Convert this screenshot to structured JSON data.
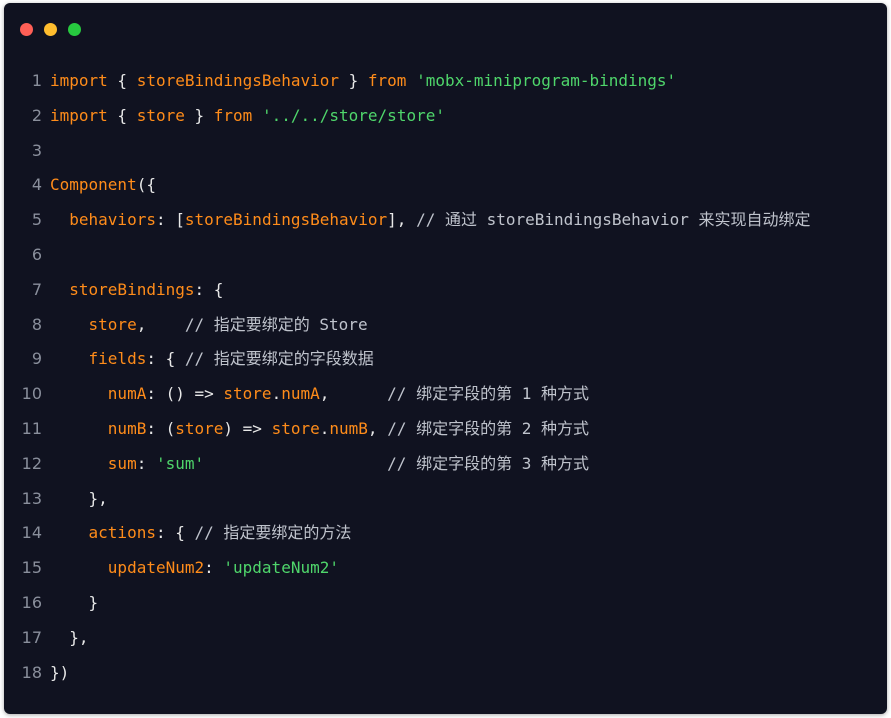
{
  "window": {
    "controls": {
      "close_color": "#ff5f56",
      "minimize_color": "#ffbd2e",
      "maximize_color": "#27c93f"
    }
  },
  "theme": {
    "background": "#101220",
    "keyword": "#ff8c1a",
    "string": "#4fd66b",
    "punctuation": "#e8e8e8",
    "comment": "#bfc3cc",
    "line_number": "#8a8f9c"
  },
  "code": {
    "lines": [
      {
        "num": "1",
        "tokens": [
          [
            "kw",
            "import"
          ],
          [
            "p",
            " { "
          ],
          [
            "id",
            "storeBindingsBehavior"
          ],
          [
            "p",
            " } "
          ],
          [
            "kw",
            "from"
          ],
          [
            "p",
            " "
          ],
          [
            "str",
            "'mobx-miniprogram-bindings'"
          ]
        ]
      },
      {
        "num": "2",
        "tokens": [
          [
            "kw",
            "import"
          ],
          [
            "p",
            " { "
          ],
          [
            "id",
            "store"
          ],
          [
            "p",
            " } "
          ],
          [
            "kw",
            "from"
          ],
          [
            "p",
            " "
          ],
          [
            "str",
            "'../../store/store'"
          ]
        ]
      },
      {
        "num": "3",
        "tokens": []
      },
      {
        "num": "4",
        "tokens": [
          [
            "id",
            "Component"
          ],
          [
            "p",
            "({"
          ]
        ]
      },
      {
        "num": "5",
        "tokens": [
          [
            "p",
            "  "
          ],
          [
            "id",
            "behaviors"
          ],
          [
            "p",
            ": ["
          ],
          [
            "id",
            "storeBindingsBehavior"
          ],
          [
            "p",
            "], "
          ],
          [
            "cm",
            "// 通过 storeBindingsBehavior 来实现自动绑定"
          ]
        ]
      },
      {
        "num": "6",
        "tokens": []
      },
      {
        "num": "7",
        "tokens": [
          [
            "p",
            "  "
          ],
          [
            "id",
            "storeBindings"
          ],
          [
            "p",
            ": {"
          ]
        ]
      },
      {
        "num": "8",
        "tokens": [
          [
            "p",
            "    "
          ],
          [
            "id",
            "store"
          ],
          [
            "p",
            ",    "
          ],
          [
            "cm",
            "// 指定要绑定的 Store"
          ]
        ]
      },
      {
        "num": "9",
        "tokens": [
          [
            "p",
            "    "
          ],
          [
            "id",
            "fields"
          ],
          [
            "p",
            ": { "
          ],
          [
            "cm",
            "// 指定要绑定的字段数据"
          ]
        ]
      },
      {
        "num": "10",
        "tokens": [
          [
            "p",
            "      "
          ],
          [
            "id",
            "numA"
          ],
          [
            "p",
            ": () => "
          ],
          [
            "id",
            "store"
          ],
          [
            "p",
            "."
          ],
          [
            "id",
            "numA"
          ],
          [
            "p",
            ",      "
          ],
          [
            "cm",
            "// 绑定字段的第 1 种方式"
          ]
        ]
      },
      {
        "num": "11",
        "tokens": [
          [
            "p",
            "      "
          ],
          [
            "id",
            "numB"
          ],
          [
            "p",
            ": ("
          ],
          [
            "id",
            "store"
          ],
          [
            "p",
            ") => "
          ],
          [
            "id",
            "store"
          ],
          [
            "p",
            "."
          ],
          [
            "id",
            "numB"
          ],
          [
            "p",
            ", "
          ],
          [
            "cm",
            "// 绑定字段的第 2 种方式"
          ]
        ]
      },
      {
        "num": "12",
        "tokens": [
          [
            "p",
            "      "
          ],
          [
            "id",
            "sum"
          ],
          [
            "p",
            ": "
          ],
          [
            "str",
            "'sum'"
          ],
          [
            "p",
            "                   "
          ],
          [
            "cm",
            "// 绑定字段的第 3 种方式"
          ]
        ]
      },
      {
        "num": "13",
        "tokens": [
          [
            "p",
            "    },"
          ]
        ]
      },
      {
        "num": "14",
        "tokens": [
          [
            "p",
            "    "
          ],
          [
            "id",
            "actions"
          ],
          [
            "p",
            ": { "
          ],
          [
            "cm",
            "// 指定要绑定的方法"
          ]
        ]
      },
      {
        "num": "15",
        "tokens": [
          [
            "p",
            "      "
          ],
          [
            "id",
            "updateNum2"
          ],
          [
            "p",
            ": "
          ],
          [
            "str",
            "'updateNum2'"
          ]
        ]
      },
      {
        "num": "16",
        "tokens": [
          [
            "p",
            "    }"
          ]
        ]
      },
      {
        "num": "17",
        "tokens": [
          [
            "p",
            "  },"
          ]
        ]
      },
      {
        "num": "18",
        "tokens": [
          [
            "p",
            "})"
          ]
        ]
      }
    ]
  }
}
